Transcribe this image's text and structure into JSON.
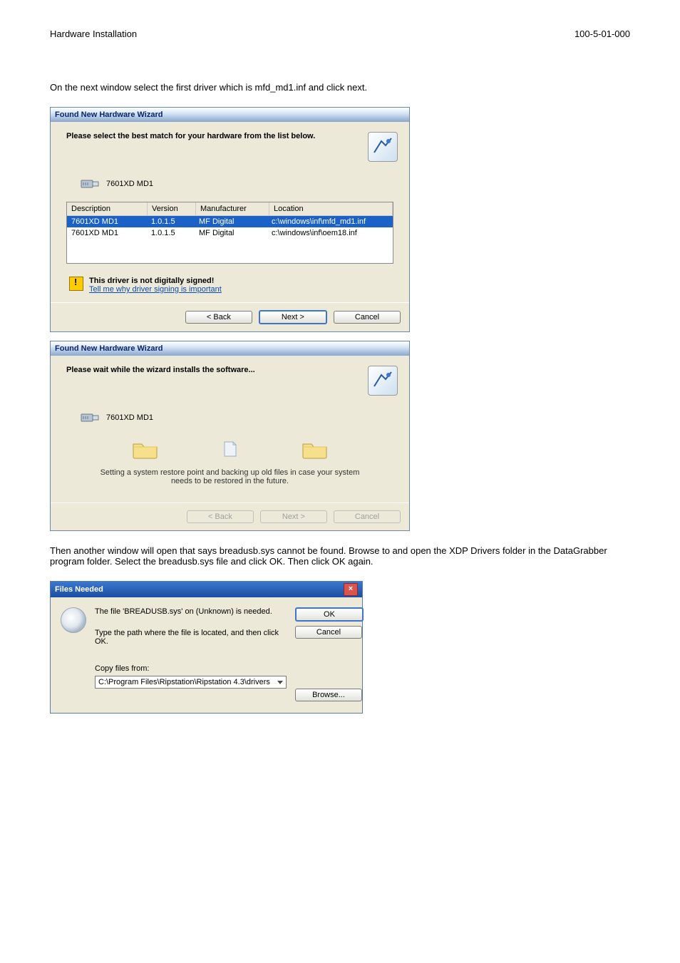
{
  "page": {
    "header_left": "Hardware Installation",
    "header_right": "100-5-01-000",
    "para1": "On the next window select the first driver which is mfd_md1.inf and click next.",
    "para2": "Then another window will open that says breadusb.sys cannot be found. Browse to and open the XDP Drivers folder in the DataGrabber program folder. Select the breadusb.sys file and click OK. Then click OK again."
  },
  "wiz1": {
    "title": "Found New Hardware Wizard",
    "prompt": "Please select the best match for your hardware from the list below.",
    "device": "7601XD MD1",
    "cols": {
      "desc": "Description",
      "ver": "Version",
      "man": "Manufacturer",
      "loc": "Location"
    },
    "rows": [
      {
        "desc": "7601XD MD1",
        "ver": "1.0.1.5",
        "man": "MF Digital",
        "loc": "c:\\windows\\inf\\mfd_md1.inf"
      },
      {
        "desc": "7601XD MD1",
        "ver": "1.0.1.5",
        "man": "MF Digital",
        "loc": "c:\\windows\\inf\\oem18.inf"
      }
    ],
    "warn_bold": "This driver is not digitally signed!",
    "warn_link": "Tell me why driver signing is important",
    "btn_back": "< Back",
    "btn_next": "Next >",
    "btn_cancel": "Cancel"
  },
  "wiz2": {
    "title": "Found New Hardware Wizard",
    "prompt": "Please wait while the wizard installs the software...",
    "device": "7601XD MD1",
    "status": "Setting a system restore point and backing up old files in case your system needs to be restored in the future.",
    "btn_back": "< Back",
    "btn_next": "Next >",
    "btn_cancel": "Cancel"
  },
  "dlg": {
    "title": "Files Needed",
    "msg1": "The file 'BREADUSB.sys' on (Unknown) is needed.",
    "msg2": "Type the path where the file is located, and then click OK.",
    "copy_label": "Copy files from:",
    "path_value": "C:\\Program Files\\Ripstation\\Ripstation 4.3\\drivers",
    "btn_ok": "OK",
    "btn_cancel": "Cancel",
    "btn_browse": "Browse..."
  }
}
